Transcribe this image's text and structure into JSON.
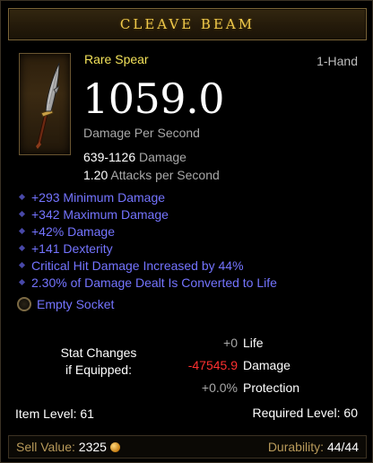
{
  "tooltip": {
    "title": "CLEAVE BEAM",
    "item_type": "Rare Spear",
    "slot": "1-Hand",
    "dps_value": "1059.0",
    "dps_label": "Damage Per Second",
    "damage_range": "639-1126",
    "damage_label": "Damage",
    "attacks_value": "1.20",
    "attacks_label": "Attacks per Second",
    "affixes": [
      "+293 Minimum Damage",
      "+342 Maximum Damage",
      "+42% Damage",
      "+141 Dexterity",
      "Critical Hit Damage Increased by 44%",
      "2.30% of Damage Dealt Is Converted to Life"
    ],
    "socket_label": "Empty Socket",
    "stat_changes": {
      "heading_line1": "Stat Changes",
      "heading_line2": "if Equipped:",
      "rows": [
        {
          "value": "+0",
          "name": "Life",
          "tone": "neutral"
        },
        {
          "value": "-47545.9",
          "name": "Damage",
          "tone": "negative"
        },
        {
          "value": "+0.0%",
          "name": "Protection",
          "tone": "neutral"
        }
      ]
    },
    "item_level_label": "Item Level: 61",
    "required_level_label": "Required Level: 60",
    "sell_value_label": "Sell Value:",
    "sell_value": "2325",
    "durability_label": "Durability:",
    "durability_value": "44/44",
    "icons": {
      "item": "spear-icon",
      "socket": "empty-socket-icon",
      "currency": "gold-coin-icon",
      "affix_bullet": "diamond-bullet-icon"
    },
    "colors": {
      "title_gold": "#f0c94a",
      "rare_yellow": "#f3e25a",
      "magic_blue": "#7474ff",
      "negative_red": "#ff3030",
      "label_gold": "#b89a5a"
    }
  }
}
